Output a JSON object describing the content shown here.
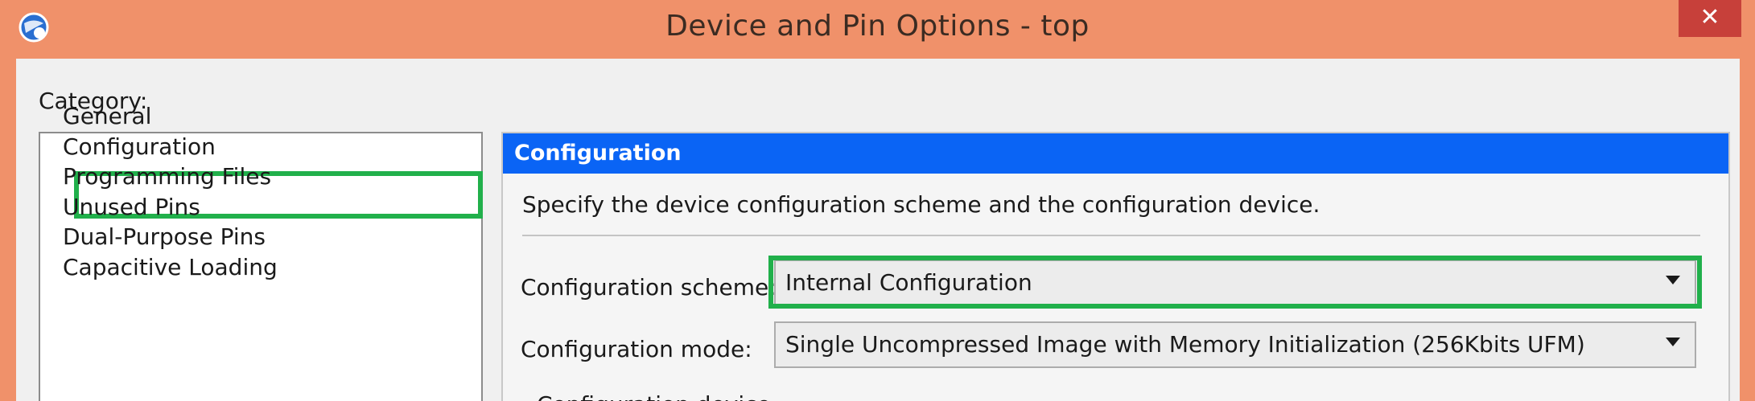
{
  "window": {
    "title": "Device and Pin Options - top",
    "close_glyph": "✕"
  },
  "category": {
    "label": "Category:",
    "items": [
      {
        "label": "General"
      },
      {
        "label": "Configuration",
        "selected": true
      },
      {
        "label": "Programming Files"
      },
      {
        "label": "Unused Pins"
      },
      {
        "label": "Dual-Purpose Pins"
      },
      {
        "label": "Capacitive Loading"
      }
    ]
  },
  "panel": {
    "header": "Configuration",
    "description": "Specify the device configuration scheme and the configuration device.",
    "scheme_label": "Configuration scheme:",
    "scheme_value": "Internal Configuration",
    "mode_label": "Configuration mode:",
    "mode_value": "Single Uncompressed Image with Memory Initialization (256Kbits UFM)",
    "partial_next_label": "Configuration device"
  },
  "colors": {
    "titlebar": "#f0916a",
    "close_button": "#c7403a",
    "panel_header": "#0a64f5",
    "highlight": "#21b04b"
  }
}
